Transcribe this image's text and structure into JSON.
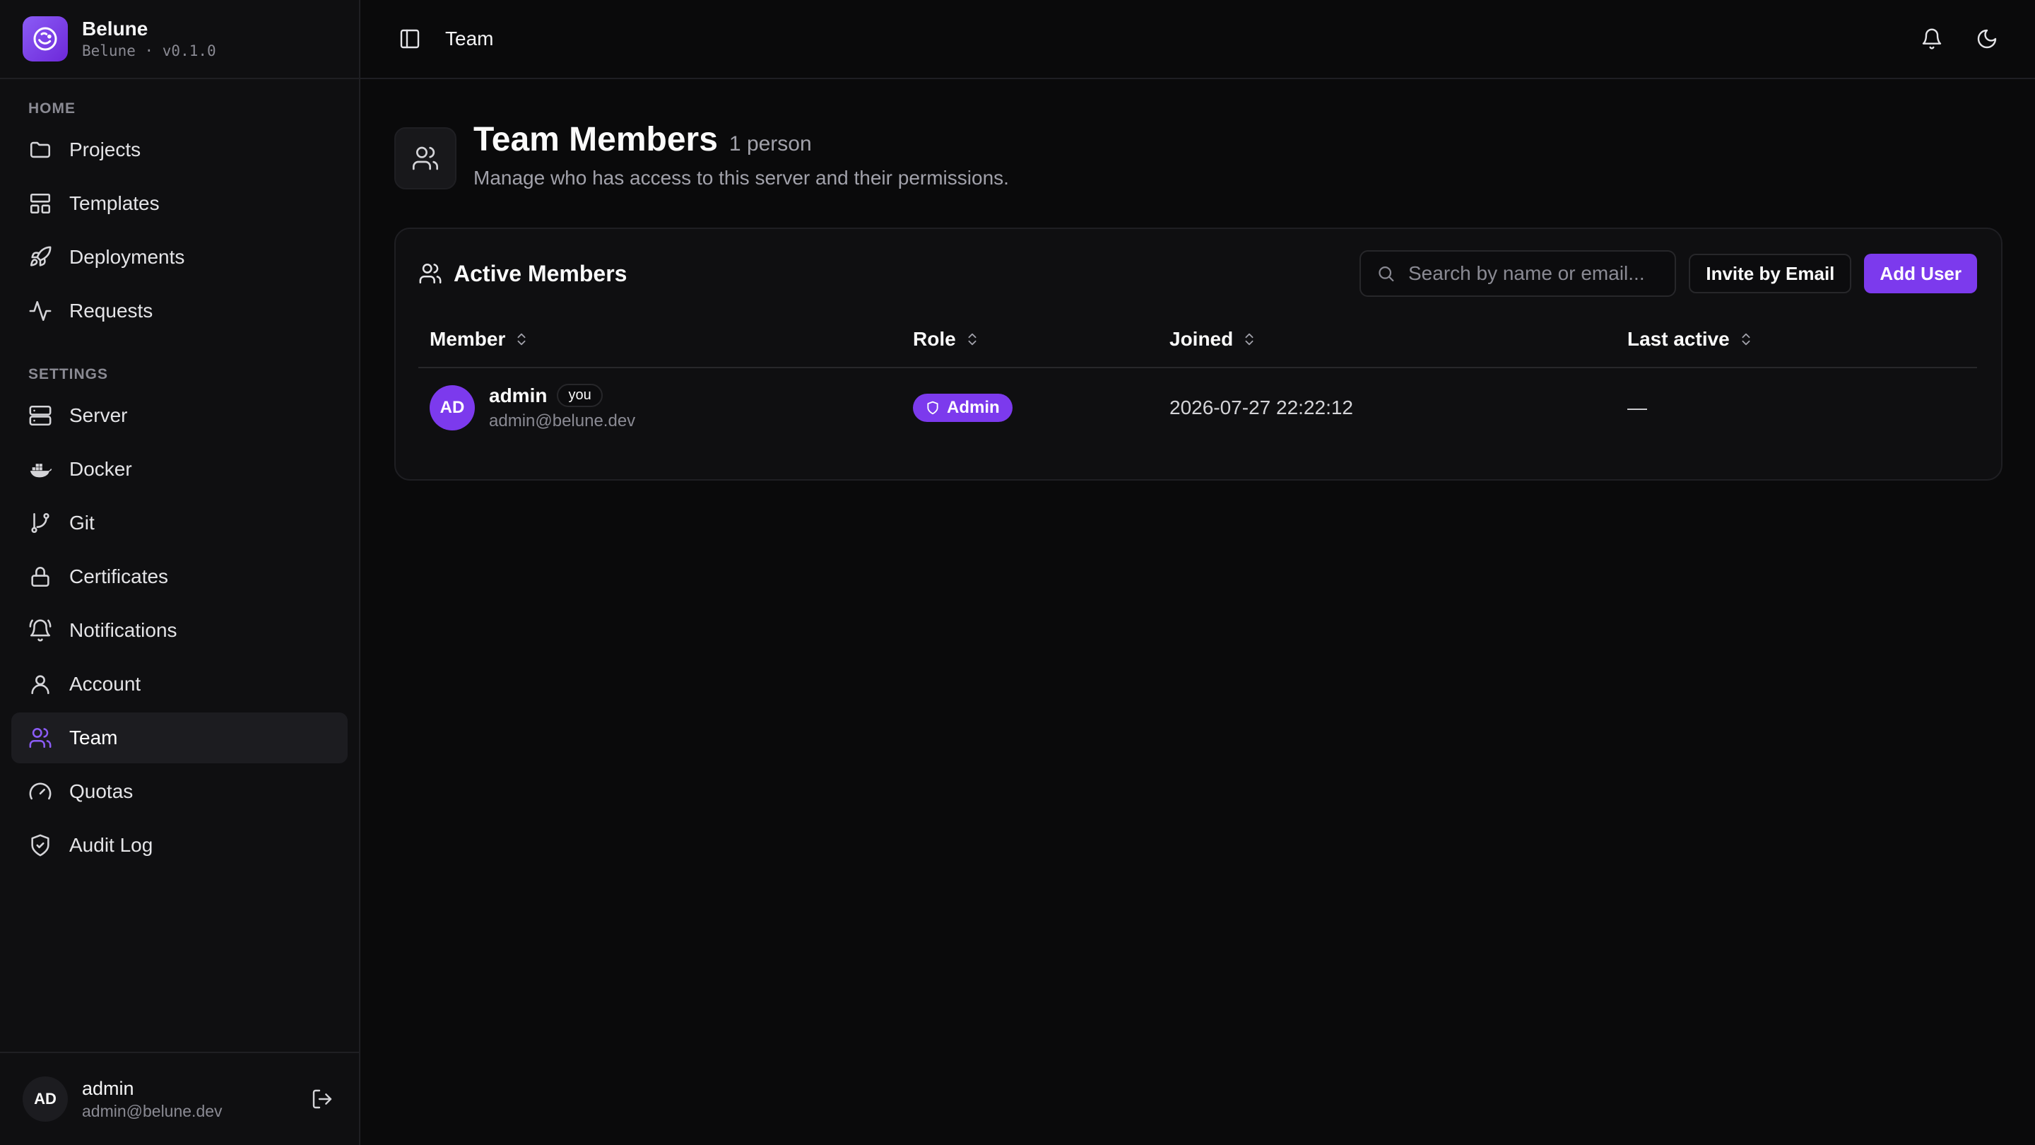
{
  "brand": {
    "name": "Belune",
    "subtitle": "Belune · v0.1.0"
  },
  "sidebar": {
    "groups": [
      {
        "label": "HOME",
        "items": [
          {
            "label": "Projects",
            "icon": "folder-icon"
          },
          {
            "label": "Templates",
            "icon": "layout-icon"
          },
          {
            "label": "Deployments",
            "icon": "rocket-icon"
          },
          {
            "label": "Requests",
            "icon": "activity-icon"
          }
        ]
      },
      {
        "label": "SETTINGS",
        "items": [
          {
            "label": "Server",
            "icon": "server-icon"
          },
          {
            "label": "Docker",
            "icon": "docker-icon"
          },
          {
            "label": "Git",
            "icon": "git-branch-icon"
          },
          {
            "label": "Certificates",
            "icon": "lock-icon"
          },
          {
            "label": "Notifications",
            "icon": "bell-ring-icon"
          },
          {
            "label": "Account",
            "icon": "user-icon"
          },
          {
            "label": "Team",
            "icon": "users-icon",
            "active": true
          },
          {
            "label": "Quotas",
            "icon": "gauge-icon"
          },
          {
            "label": "Audit Log",
            "icon": "shield-check-icon"
          }
        ]
      }
    ],
    "user": {
      "initials": "AD",
      "name": "admin",
      "email": "admin@belune.dev"
    }
  },
  "topbar": {
    "title": "Team"
  },
  "page": {
    "title": "Team Members",
    "count": "1 person",
    "description": "Manage who has access to this server and their permissions."
  },
  "card": {
    "title": "Active Members",
    "search_placeholder": "Search by name or email...",
    "invite_label": "Invite by Email",
    "add_label": "Add User"
  },
  "table": {
    "columns": [
      "Member",
      "Role",
      "Joined",
      "Last active"
    ],
    "rows": [
      {
        "initials": "AD",
        "name": "admin",
        "you_badge": "you",
        "email": "admin@belune.dev",
        "role": "Admin",
        "joined": "2026-07-27 22:22:12",
        "last_active": "—"
      }
    ]
  },
  "colors": {
    "accent": "#7c3aed",
    "background": "#0a0a0b",
    "sidebar": "#0f0f11"
  }
}
